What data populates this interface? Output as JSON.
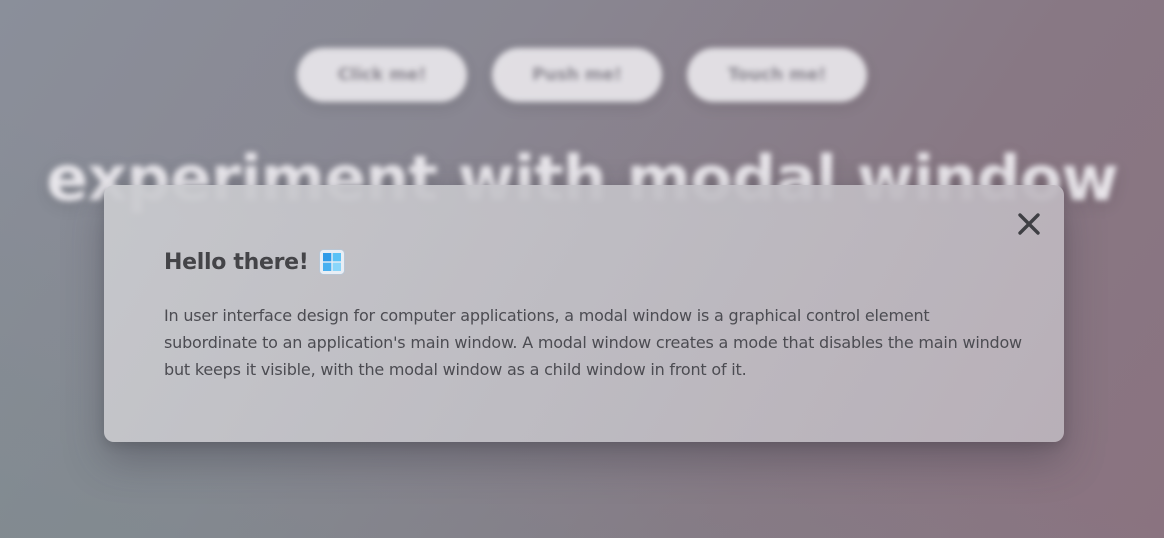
{
  "background": {
    "buttons": [
      {
        "label": "Click me!"
      },
      {
        "label": "Push me!"
      },
      {
        "label": "Touch me!"
      }
    ],
    "title": "experiment with modal window"
  },
  "modal": {
    "heading": "Hello there!",
    "heading_icon": "windows-logo-icon",
    "close_icon": "close-icon",
    "body": "In user interface design for computer applications, a modal window is a graphical control element subordinate to an application's main window. A modal window creates a mode that disables the main window but keeps it visible, with the modal window as a child window in front of it."
  },
  "colors": {
    "overlay_gradient_start": "#8a8f9a",
    "overlay_gradient_end": "#8a7380",
    "modal_background": "#c6c5ca",
    "text": "#4c4c52",
    "heading": "#444448"
  }
}
